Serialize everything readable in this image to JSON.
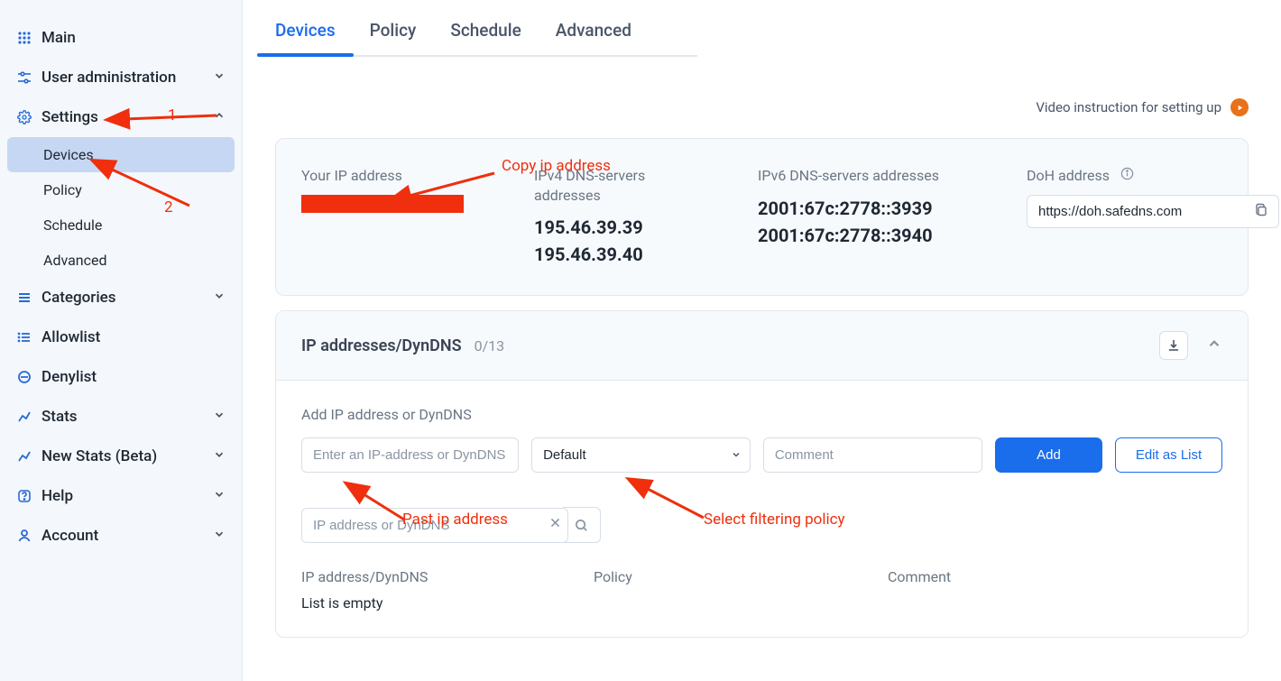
{
  "sidebar": {
    "main": "Main",
    "user_admin": "User administration",
    "settings": "Settings",
    "settings_sub": {
      "devices": "Devices",
      "policy": "Policy",
      "schedule": "Schedule",
      "advanced": "Advanced"
    },
    "categories": "Categories",
    "allowlist": "Allowlist",
    "denylist": "Denylist",
    "stats": "Stats",
    "new_stats": "New Stats (Beta)",
    "help": "Help",
    "account": "Account"
  },
  "tabs": {
    "devices": "Devices",
    "policy": "Policy",
    "schedule": "Schedule",
    "advanced": "Advanced"
  },
  "video_link": "Video instruction for setting up",
  "ip_info": {
    "your_ip_label": "Your IP address",
    "ipv4_label": "IPv4 DNS-servers addresses",
    "ipv4_1": "195.46.39.39",
    "ipv4_2": "195.46.39.40",
    "ipv6_label": "IPv6 DNS-servers addresses",
    "ipv6_1": "2001:67c:2778::3939",
    "ipv6_2": "2001:67c:2778::3940",
    "doh_label": "DoH address",
    "doh_value": "https://doh.safedns.com"
  },
  "section": {
    "title": "IP addresses/DynDNS",
    "count": "0/13",
    "add_label": "Add IP address or DynDNS",
    "ip_placeholder": "Enter an IP-address or DynDNS",
    "policy_default": "Default",
    "comment_placeholder": "Comment",
    "add_btn": "Add",
    "edit_btn": "Edit as List",
    "search_placeholder": "IP address or DynDNS",
    "th_ip": "IP address/DynDNS",
    "th_policy": "Policy",
    "th_comment": "Comment",
    "empty": "List is empty"
  },
  "annotations": {
    "n1": "1",
    "n2": "2",
    "copy_ip": "Copy ip address",
    "paste_ip": "Past ip address",
    "select_policy": "Select filtering policy"
  }
}
